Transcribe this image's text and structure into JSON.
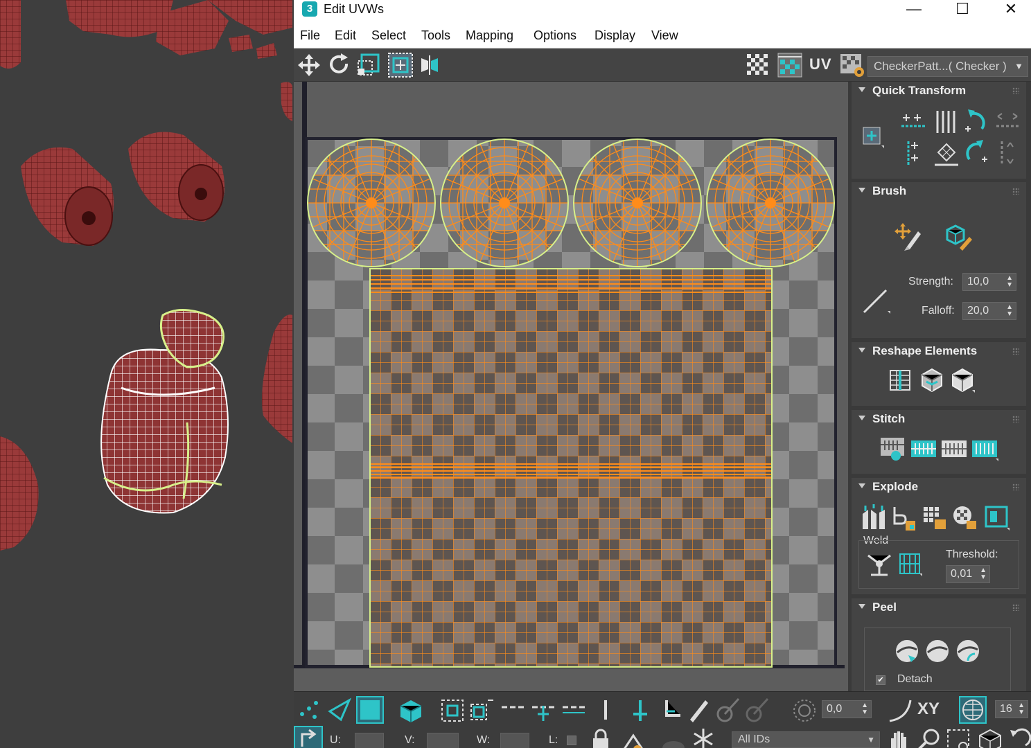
{
  "window": {
    "title": "Edit UVWs",
    "app_icon_glyph": "3",
    "minimize_glyph": "—",
    "maximize_glyph": "☐",
    "close_glyph": "✕"
  },
  "menu": [
    "File",
    "Edit",
    "Select",
    "Tools",
    "Mapping",
    "Options",
    "Display",
    "View"
  ],
  "toolbar": {
    "uv_label": "UV",
    "texture_dropdown": "CheckerPatt...( Checker )",
    "dropdown_arrow": "▼"
  },
  "panel": {
    "quick_transform": {
      "title": "Quick Transform"
    },
    "brush": {
      "title": "Brush",
      "strength_label": "Strength:",
      "strength_value": "10,0",
      "falloff_label": "Falloff:",
      "falloff_value": "20,0"
    },
    "reshape": {
      "title": "Reshape Elements"
    },
    "stitch": {
      "title": "Stitch"
    },
    "explode": {
      "title": "Explode",
      "weld_label": "Weld",
      "threshold_label": "Threshold:",
      "threshold_value": "0,01"
    },
    "peel": {
      "title": "Peel",
      "detach_label": "Detach",
      "detach_checked": true,
      "check_glyph": "✔"
    }
  },
  "bottom_toolbar": {
    "soft_select_value": "0,0",
    "xy_label": "XY",
    "grid_value": "16",
    "u_label": "U:",
    "v_label": "V:",
    "w_label": "W:",
    "l_label": "L:",
    "id_filter": "All IDs"
  },
  "colors": {
    "accent_cyan": "#2ec4c8",
    "wire_orange": "#ff8c1a",
    "selection_green": "#d7f08a",
    "mesh_red": "#9b3535"
  }
}
